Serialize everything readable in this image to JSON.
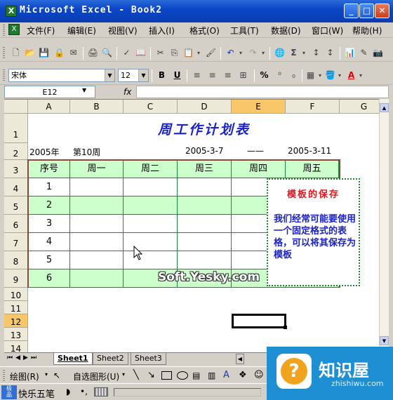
{
  "window": {
    "title": "Microsoft Excel - Book2",
    "app_icon": "X"
  },
  "menu": [
    "文件(F)",
    "编辑(E)",
    "视图(V)",
    "插入(I)",
    "格式(O)",
    "工具(T)",
    "数据(D)",
    "窗口(W)",
    "帮助(H)"
  ],
  "format_toolbar": {
    "font": "宋体",
    "size": "12",
    "bold": "B",
    "underline": "U",
    "percent": "%"
  },
  "formula_bar": {
    "name_box": "E12",
    "fx": "fx",
    "value": ""
  },
  "columns": [
    "A",
    "B",
    "C",
    "D",
    "E",
    "F",
    "G"
  ],
  "rows": [
    "1",
    "2",
    "3",
    "4",
    "5",
    "6",
    "7",
    "8",
    "9",
    "10",
    "11",
    "12",
    "13",
    "14"
  ],
  "sheet": {
    "title": "周工作计划表",
    "row2": {
      "year": "2005年",
      "week": "第10周",
      "start": "2005-3-7",
      "dash": "——",
      "end": "2005-3-11"
    },
    "headers": [
      "序号",
      "周一",
      "周二",
      "周三",
      "周四",
      "周五"
    ],
    "numbers": [
      "1",
      "2",
      "3",
      "4",
      "5",
      "6"
    ]
  },
  "comment": {
    "title": "模板的保存",
    "body": "我们经常可能要使用一个固定格式的表格，可以将其保存为模板"
  },
  "watermark": "Soft.Yesky.com",
  "tabs": [
    "Sheet1",
    "Sheet2",
    "Sheet3"
  ],
  "drawbar": {
    "draw": "绘图(R)",
    "autoshapes": "自选图形(U)"
  },
  "ime": {
    "name": "快乐五笔"
  },
  "logo": {
    "name": "知识屋",
    "url": "zhishiwu.com"
  },
  "colors": {
    "title_blue": "#0b46c8",
    "table_green": "#ccffcc",
    "border_green": "#1c8a3c",
    "comment_red": "#e0181e",
    "comment_blue": "#1a22c8",
    "selected_header": "#f9c66a"
  }
}
